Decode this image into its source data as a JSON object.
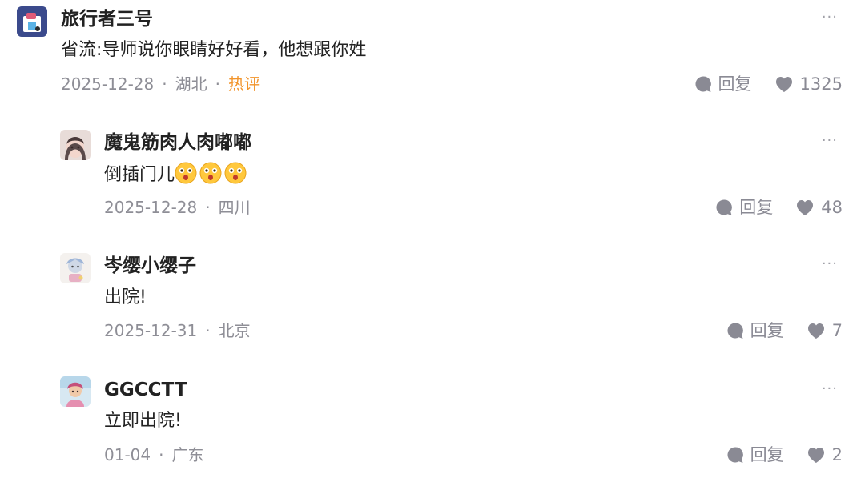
{
  "comments": [
    {
      "author": "旅行者三号",
      "content": "省流:导师说你眼睛好好看，他想跟你姓",
      "date": "2025-12-28",
      "location": "湖北",
      "tag": "热评",
      "reply_label": "回复",
      "likes": "1325",
      "more_label": "···"
    },
    {
      "author": "魔鬼筋肉人肉嘟嘟",
      "content": "倒插门儿",
      "emojis": [
        "surprised-face-emoji",
        "surprised-face-emoji",
        "surprised-face-emoji"
      ],
      "date": "2025-12-28",
      "location": "四川",
      "reply_label": "回复",
      "likes": "48",
      "more_label": "···"
    },
    {
      "author": "岑缨小缨子",
      "content": "出院!",
      "date": "2025-12-31",
      "location": "北京",
      "reply_label": "回复",
      "likes": "7",
      "more_label": "···"
    },
    {
      "author": "GGCCTT",
      "content": "立即出院!",
      "date": "01-04",
      "location": "广东",
      "reply_label": "回复",
      "likes": "2",
      "more_label": "···"
    }
  ],
  "meta_separator": "·",
  "colors": {
    "hot_tag": "#f2942b",
    "meta_text": "#8e8e96",
    "icon": "#8a8a94"
  },
  "icons": [
    "chat-bubble-icon",
    "heart-icon",
    "more-icon"
  ]
}
